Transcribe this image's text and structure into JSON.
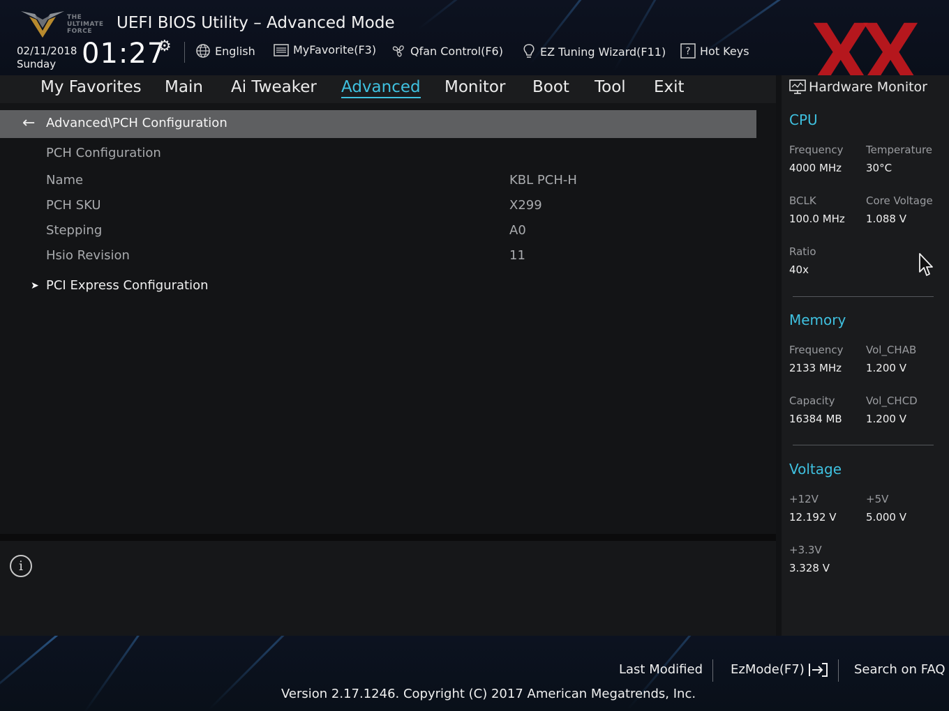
{
  "header": {
    "logo_text_lines": [
      "THE",
      "ULTIMATE",
      "FORCE"
    ],
    "title": "UEFI BIOS Utility – Advanced Mode",
    "date": "02/11/2018",
    "weekday": "Sunday",
    "time": "01:27",
    "tools": [
      {
        "label": "English",
        "icon": "globe-icon"
      },
      {
        "label": "MyFavorite(F3)",
        "icon": "list-icon"
      },
      {
        "label": "Qfan Control(F6)",
        "icon": "fan-icon"
      },
      {
        "label": "EZ Tuning Wizard(F11)",
        "icon": "bulb-icon"
      },
      {
        "label": "Hot Keys",
        "icon": "help-icon"
      }
    ],
    "watermark": "XX"
  },
  "menu": {
    "items": [
      "My Favorites",
      "Main",
      "Ai Tweaker",
      "Advanced",
      "Monitor",
      "Boot",
      "Tool",
      "Exit"
    ],
    "active": "Advanced"
  },
  "main": {
    "breadcrumb": "Advanced\\PCH Configuration",
    "section_title": "PCH Configuration",
    "rows": [
      {
        "label": "Name",
        "value": "KBL PCH-H"
      },
      {
        "label": "PCH SKU",
        "value": "X299"
      },
      {
        "label": "Stepping",
        "value": "A0"
      },
      {
        "label": "Hsio Revision",
        "value": "11"
      }
    ],
    "submenu": "PCI Express Configuration"
  },
  "hardware_monitor": {
    "title": "Hardware Monitor",
    "cpu": {
      "heading": "CPU",
      "frequency_label": "Frequency",
      "frequency": "4000 MHz",
      "temperature_label": "Temperature",
      "temperature": "30°C",
      "bclk_label": "BCLK",
      "bclk": "100.0 MHz",
      "core_voltage_label": "Core Voltage",
      "core_voltage": "1.088 V",
      "ratio_label": "Ratio",
      "ratio": "40x"
    },
    "memory": {
      "heading": "Memory",
      "frequency_label": "Frequency",
      "frequency": "2133 MHz",
      "vol_chab_label": "Vol_CHAB",
      "vol_chab": "1.200 V",
      "capacity_label": "Capacity",
      "capacity": "16384 MB",
      "vol_chcd_label": "Vol_CHCD",
      "vol_chcd": "1.200 V"
    },
    "voltage": {
      "heading": "Voltage",
      "v12_label": "+12V",
      "v12": "12.192 V",
      "v5_label": "+5V",
      "v5": "5.000 V",
      "v33_label": "+3.3V",
      "v33": "3.328 V"
    }
  },
  "footer": {
    "last_modified": "Last Modified",
    "ezmode": "EzMode(F7)",
    "search_faq": "Search on FAQ",
    "version": "Version 2.17.1246. Copyright (C) 2017 American Megatrends, Inc."
  },
  "colors": {
    "accent": "#3fc1e0",
    "watermark": "#c8181e",
    "breadcrumb_bar": "#5e5f61"
  }
}
